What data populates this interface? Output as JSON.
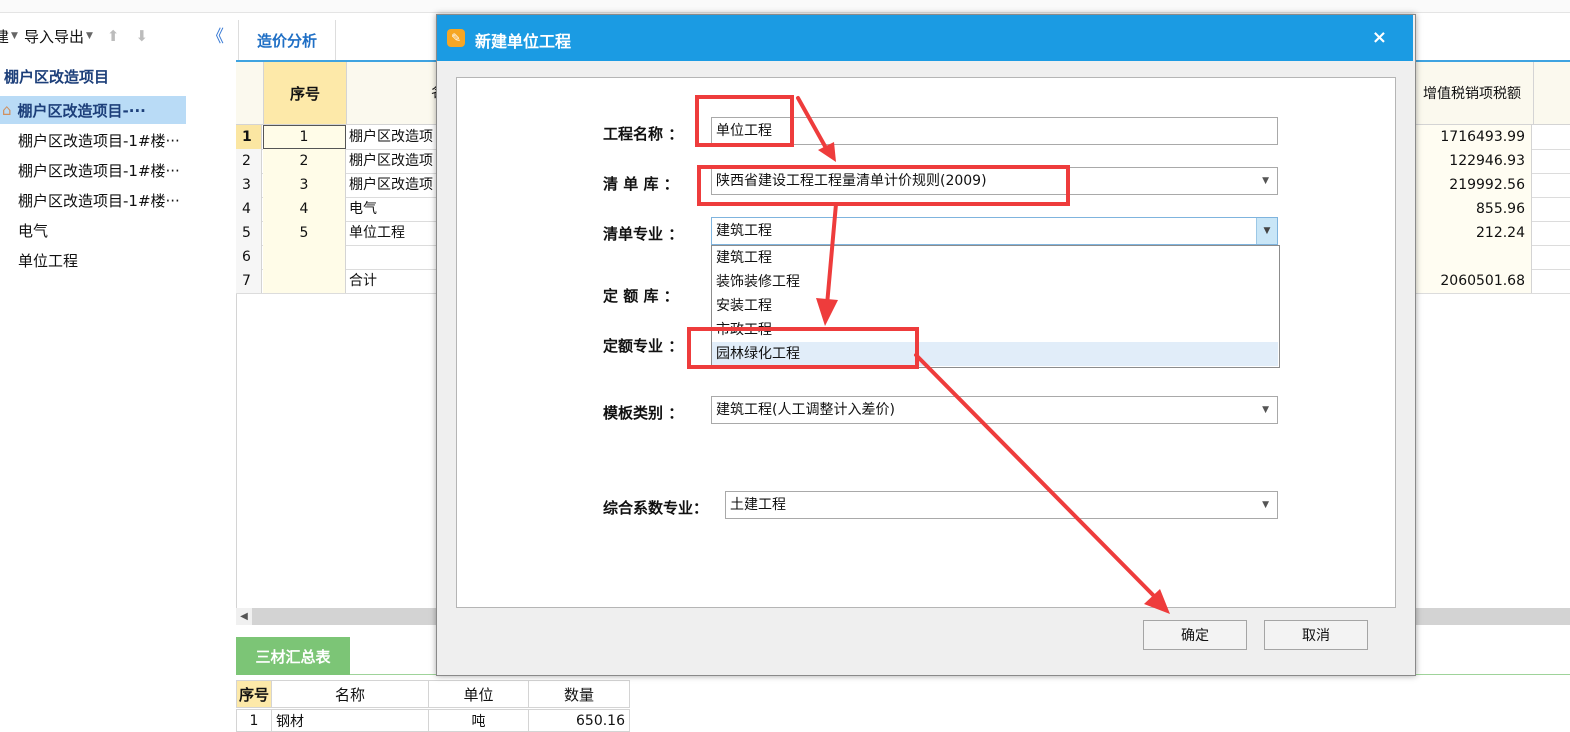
{
  "toolbar": {
    "new_label": "建",
    "import_export_label": "导入导出"
  },
  "tree": {
    "root": "棚户区改造项目",
    "selected": "棚户区改造项目-···",
    "items": [
      "棚户区改造项目-1#楼···",
      "棚户区改造项目-1#楼···",
      "棚户区改造项目-1#楼···",
      "电气",
      "单位工程"
    ]
  },
  "tabs": {
    "cost_analysis": "造价分析"
  },
  "grid": {
    "header_seq": "序号",
    "header_name_partial": "名",
    "header_tax": "增值税销项税额",
    "rows": [
      {
        "n": "1",
        "seq": "1",
        "name": "棚户区改造项",
        "tax": "1716493.99"
      },
      {
        "n": "2",
        "seq": "2",
        "name": "棚户区改造项",
        "tax": "122946.93"
      },
      {
        "n": "3",
        "seq": "3",
        "name": "棚户区改造项",
        "tax": "219992.56"
      },
      {
        "n": "4",
        "seq": "4",
        "name": "电气",
        "tax": "855.96"
      },
      {
        "n": "5",
        "seq": "5",
        "name": "单位工程",
        "tax": "212.24"
      },
      {
        "n": "6",
        "seq": "",
        "name": "",
        "tax": ""
      },
      {
        "n": "7",
        "seq": "",
        "name": "合计",
        "tax": "2060501.68"
      }
    ]
  },
  "bottom": {
    "tab": "三材汇总表",
    "headers": [
      "序号",
      "名称",
      "单位",
      "数量"
    ],
    "row": [
      "1",
      "钢材",
      "吨",
      "650.16"
    ]
  },
  "dialog": {
    "title": "新建单位工程",
    "close": "×",
    "labels": {
      "project_name": "工程名称 ：",
      "bill_lib": "清 单 库 ：",
      "bill_major": "清单专业 ：",
      "quota_lib": "定 额 库 ：",
      "quota_major": "定额专业 ：",
      "template_type": "模板类别 ：",
      "coef_major": "综合系数专业："
    },
    "values": {
      "project_name": "单位工程",
      "bill_lib": "陕西省建设工程工程量清单计价规则(2009)",
      "bill_major": "建筑工程",
      "template_type": "建筑工程(人工调整计入差价)",
      "coef_major": "土建工程"
    },
    "dropdown_options": [
      "建筑工程",
      "装饰装修工程",
      "安装工程",
      "市政工程",
      "园林绿化工程"
    ],
    "ok": "确定",
    "cancel": "取消"
  },
  "annotation_color": "#ee3c3c"
}
